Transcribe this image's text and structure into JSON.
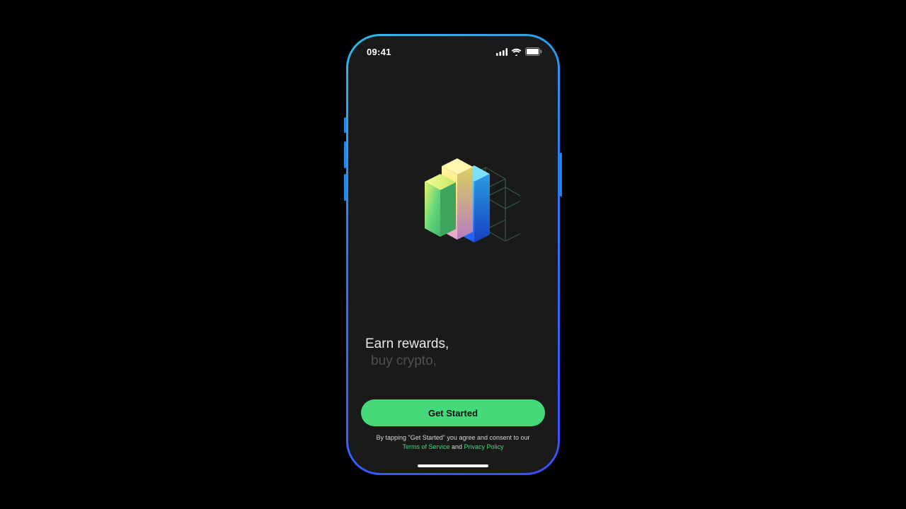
{
  "status": {
    "time": "09:41"
  },
  "hero": {
    "headline": "Earn rewards,",
    "subline": "buy crypto,"
  },
  "cta": {
    "button_label": "Get Started",
    "consent_prefix": "By tapping \"Get Started\" you agree and consent to our",
    "terms_label": "Terms of Service",
    "joiner": " and ",
    "privacy_label": "Privacy Policy"
  },
  "colors": {
    "accent": "#45d97a",
    "surface": "#1a1a1a",
    "frame_gradient_start": "#29bce8",
    "frame_gradient_end": "#3a4dff"
  }
}
